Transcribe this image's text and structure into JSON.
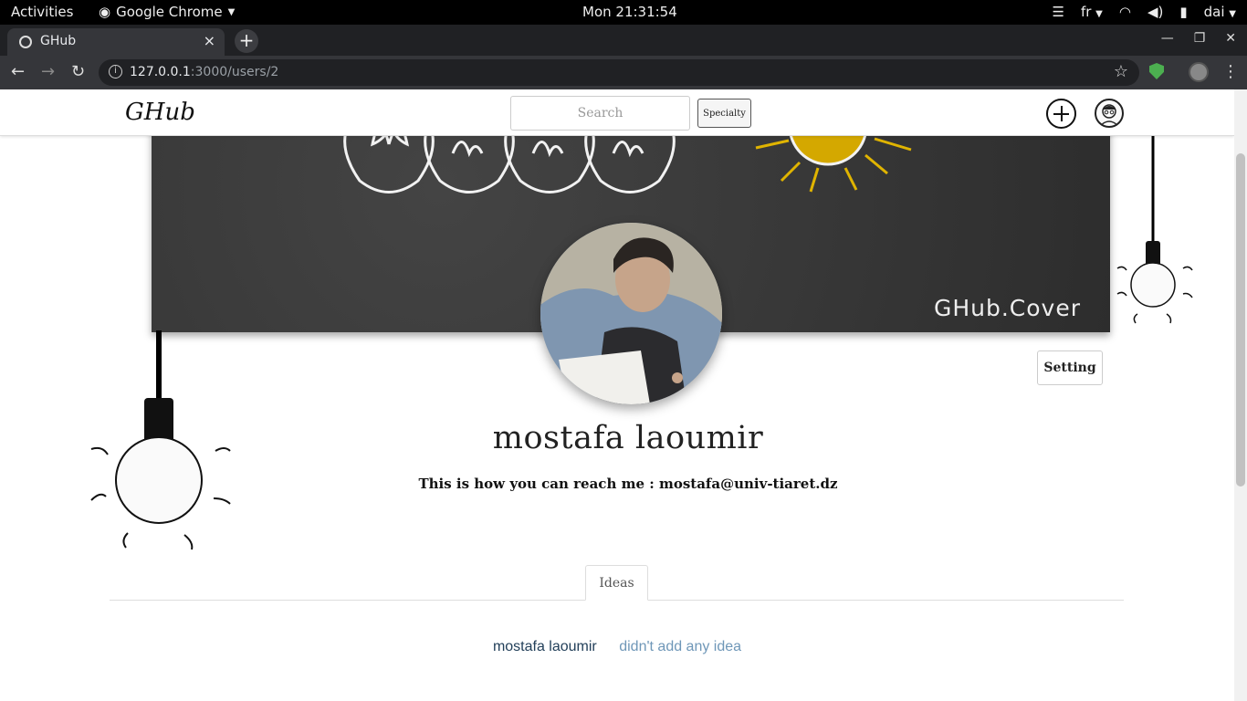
{
  "system_bar": {
    "activities": "Activities",
    "app_name": "Google Chrome",
    "clock": "Mon 21:31:54",
    "lang": "fr",
    "user": "dai"
  },
  "browser": {
    "tab_title": "GHub",
    "url_host": "127.0.0.1",
    "url_path": ":3000/users/2"
  },
  "site": {
    "logo": "GHub",
    "search_placeholder": "Search",
    "specialty_label": "Specialty",
    "cover_brand": "GHub.Cover"
  },
  "profile": {
    "setting_label": "Setting",
    "name": "mostafa laoumir",
    "contact": "This is how you can reach me : mostafa@univ-tiaret.dz"
  },
  "tabs": {
    "ideas_label": "Ideas"
  },
  "ideas": {
    "user": "mostafa laoumir",
    "empty_text": "didn't add any idea"
  }
}
